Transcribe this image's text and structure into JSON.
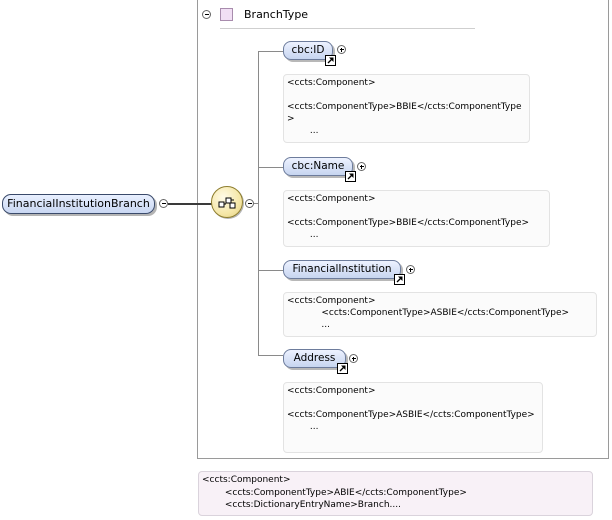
{
  "root_element": {
    "label": "FinancialInstitutionBranch",
    "toggle_state": "expanded"
  },
  "compositor": {
    "kind": "sequence",
    "icon": "sequence-compositor-icon",
    "toggle_state": "expanded"
  },
  "complex_type": {
    "name": "BranchType",
    "icon": "complex-type-icon",
    "toggle_state": "expanded"
  },
  "children": [
    {
      "label": "cbc:ID",
      "is_reference": true,
      "toggle_state": "collapsed",
      "doc": "<ccts:Component>\n\n<ccts:ComponentType>BBIE</ccts:ComponentType>\n        ..."
    },
    {
      "label": "cbc:Name",
      "is_reference": true,
      "toggle_state": "collapsed",
      "doc": "<ccts:Component>\n\n<ccts:ComponentType>BBIE</ccts:ComponentType>\n        ..."
    },
    {
      "label": "FinancialInstitution",
      "is_reference": true,
      "toggle_state": "collapsed",
      "doc": "<ccts:Component>\n            <ccts:ComponentType>ASBIE</ccts:ComponentType>\n            ..."
    },
    {
      "label": "Address",
      "is_reference": true,
      "toggle_state": "collapsed",
      "doc": "<ccts:Component>\n\n<ccts:ComponentType>ASBIE</ccts:ComponentType>\n        ..."
    }
  ],
  "type_documentation": "<ccts:Component>\n        <ccts:ComponentType>ABIE</ccts:ComponentType>\n        <ccts:DictionaryEntryName>Branch...."
}
